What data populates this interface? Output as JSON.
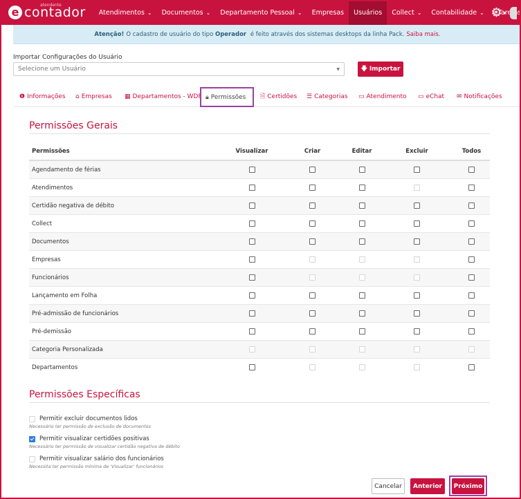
{
  "nav": {
    "logo_small": "atendente",
    "logo_text": "contador",
    "items": [
      {
        "label": "Atendimentos",
        "has_dropdown": true
      },
      {
        "label": "Documentos",
        "has_dropdown": true
      },
      {
        "label": "Departamento Pessoal",
        "has_dropdown": true
      },
      {
        "label": "Empresas",
        "has_dropdown": false
      },
      {
        "label": "Usuários",
        "has_dropdown": false,
        "active": true
      },
      {
        "label": "Collect",
        "has_dropdown": true
      },
      {
        "label": "Contabilidade",
        "has_dropdown": true
      },
      {
        "label": "eTarefas",
        "has_dropdown": true
      }
    ]
  },
  "alert": {
    "strong": "Atenção!",
    "text_1": "O cadastro de usuário do tipo",
    "strong_2": "Operador",
    "text_2": "é feito através dos sistemas desktops da linha Pack.",
    "link": "Saiba mais."
  },
  "import": {
    "label": "Importar Configurações do Usuário",
    "select_placeholder": "Selecione um Usuário",
    "button": "Importar"
  },
  "tabs": [
    {
      "label": "Informações",
      "icon": "info-icon"
    },
    {
      "label": "Empresas",
      "icon": "home-icon"
    },
    {
      "label": "Departamentos - WDP",
      "icon": "building-icon"
    },
    {
      "label": "Permissões",
      "icon": "lock-icon",
      "active": true
    },
    {
      "label": "Certidões",
      "icon": "document-icon"
    },
    {
      "label": "Categorias",
      "icon": "list-icon"
    },
    {
      "label": "Atendimento",
      "icon": "monitor-icon"
    },
    {
      "label": "eChat",
      "icon": "monitor-icon"
    },
    {
      "label": "Notificações",
      "icon": "envelope-icon"
    }
  ],
  "general": {
    "title": "Permissões Gerais",
    "columns": [
      "Permissões",
      "Visualizar",
      "Criar",
      "Editar",
      "Excluir",
      "Todos"
    ],
    "rows": [
      {
        "name": "Agendamento de férias",
        "enabled": [
          true,
          true,
          true,
          true,
          true
        ]
      },
      {
        "name": "Atendimentos",
        "enabled": [
          true,
          true,
          true,
          false,
          true
        ]
      },
      {
        "name": "Certidão negativa de débito",
        "enabled": [
          true,
          true,
          true,
          true,
          true
        ]
      },
      {
        "name": "Collect",
        "enabled": [
          true,
          true,
          true,
          true,
          true
        ]
      },
      {
        "name": "Documentos",
        "enabled": [
          true,
          true,
          true,
          true,
          true
        ]
      },
      {
        "name": "Empresas",
        "enabled": [
          true,
          false,
          false,
          false,
          true
        ]
      },
      {
        "name": "Funcionários",
        "enabled": [
          true,
          false,
          false,
          false,
          true
        ]
      },
      {
        "name": "Lançamento em Folha",
        "enabled": [
          true,
          true,
          true,
          true,
          true
        ]
      },
      {
        "name": "Pré-admissão de funcionários",
        "enabled": [
          true,
          true,
          true,
          true,
          true
        ]
      },
      {
        "name": "Pré-demissão",
        "enabled": [
          true,
          true,
          true,
          true,
          true
        ]
      },
      {
        "name": "Categoria Personalizada",
        "enabled": [
          false,
          false,
          false,
          false,
          false
        ]
      },
      {
        "name": "Departamentos",
        "enabled": [
          true,
          false,
          false,
          false,
          true
        ]
      }
    ]
  },
  "specific": {
    "title": "Permissões Específicas",
    "items": [
      {
        "label": "Permitir excluir documentos lidos",
        "note": "Necessário ter permissão de exclusão de documentos",
        "checked": false,
        "disabled": true
      },
      {
        "label": "Permitir visualizar certidões positivas",
        "note": "Necessário ter permissão de visualizar certidão negativa de débito",
        "checked": true,
        "disabled": false
      },
      {
        "label": "Permitir visualizar salário dos funcionários",
        "note": "Necessita ter permissão mínima de 'Visualizar' funcionários",
        "checked": false,
        "disabled": true
      }
    ]
  },
  "buttons": {
    "cancel": "Cancelar",
    "previous": "Anterior",
    "next": "Próximo"
  }
}
